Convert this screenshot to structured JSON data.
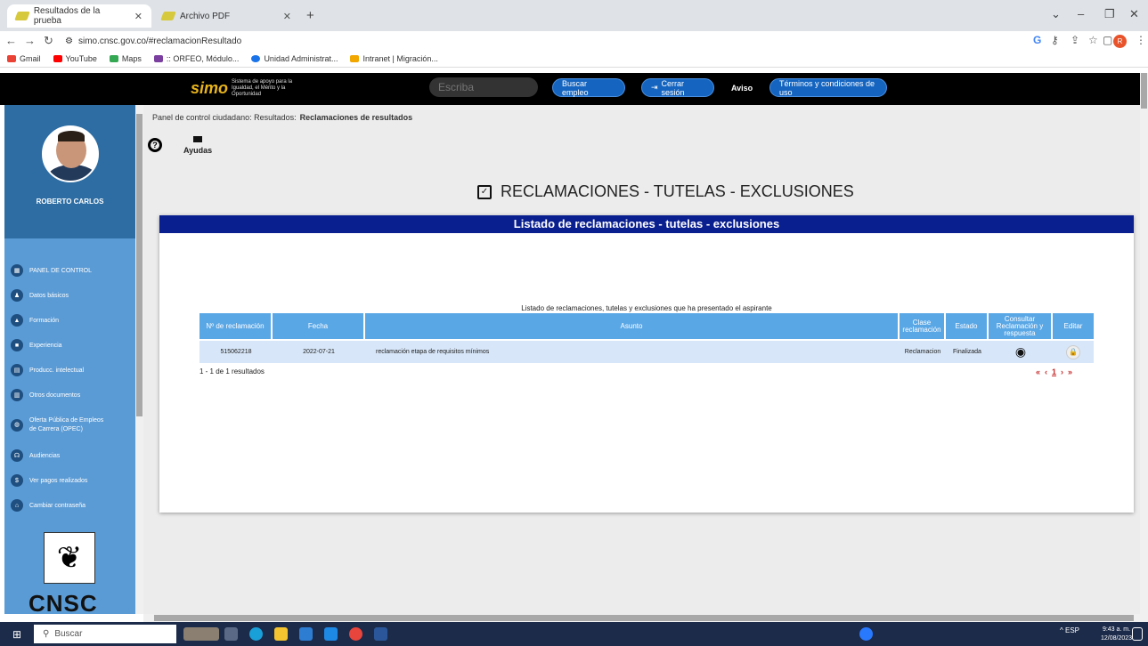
{
  "browser": {
    "tabs": [
      {
        "label": "Resultados de la prueba"
      },
      {
        "label": "Archivo PDF"
      }
    ],
    "url": "simo.cnsc.gov.co/#reclamacionResultado",
    "profile_initial": "R",
    "bookmarks": [
      {
        "label": "Gmail"
      },
      {
        "label": "YouTube"
      },
      {
        "label": "Maps"
      },
      {
        "label": ":: ORFEO, Módulo..."
      },
      {
        "label": "Unidad Administrat..."
      },
      {
        "label": "Intranet | Migración..."
      }
    ]
  },
  "header": {
    "logo_text": "simo",
    "logo_tagline": "Sistema de apoyo para la Igualdad, el Mérito y la Oportunidad",
    "search_placeholder": "Escriba",
    "buscar_empleo": "Buscar empleo",
    "cerrar_sesion": "Cerrar sesión",
    "aviso": "Aviso",
    "terminos": "Términos y condiciones de uso"
  },
  "sidebar": {
    "user_name": "ROBERTO CARLOS",
    "items": [
      {
        "label": "PANEL DE CONTROL"
      },
      {
        "label": "Datos básicos"
      },
      {
        "label": "Formación"
      },
      {
        "label": "Experiencia"
      },
      {
        "label": "Producc. intelectual"
      },
      {
        "label": "Otros documentos"
      },
      {
        "label": "Oferta Pública de Empleos de Carrera (OPEC)"
      },
      {
        "label": "Audiencias"
      },
      {
        "label": "Ver pagos realizados"
      },
      {
        "label": "Cambiar contraseña"
      }
    ],
    "footer_logo_text": "CNSC"
  },
  "main": {
    "breadcrumb_prefix": "Panel de control ciudadano: Resultados:",
    "breadcrumb_current": "Reclamaciones de resultados",
    "ayudas": "Ayudas",
    "page_title": "RECLAMACIONES - TUTELAS - EXCLUSIONES",
    "panel_title": "Listado de reclamaciones - tutelas - exclusiones",
    "caption": "Listado de reclamaciones, tutelas y exclusiones que ha presentado el aspirante",
    "columns": [
      "Nº de reclamación",
      "Fecha",
      "Asunto",
      "Clase reclamación",
      "Estado",
      "Consultar Reclamación y respuesta",
      "Editar"
    ],
    "rows": [
      {
        "numero": "515062218",
        "fecha": "2022-07-21",
        "asunto": "reclamación etapa de requisitos mínimos",
        "clase": "Reclamacion",
        "estado": "Finalizada"
      }
    ],
    "results_text": "1 - 1 de 1 resultados",
    "pager": {
      "first": "«",
      "prev": "‹",
      "current": "1",
      "next": "›",
      "last": "»"
    }
  },
  "taskbar": {
    "search_placeholder": "Buscar",
    "lang": "ESP",
    "time": "9:43 a. m.",
    "date": "12/08/2023"
  },
  "colors": {
    "header_bg": "#000000",
    "sidebar_bg": "#5b9bd5",
    "panel_head": "#0a1f8f",
    "table_head": "#5aa7e6",
    "row_bg": "#d7e6f8",
    "pager_red": "#c62828"
  }
}
